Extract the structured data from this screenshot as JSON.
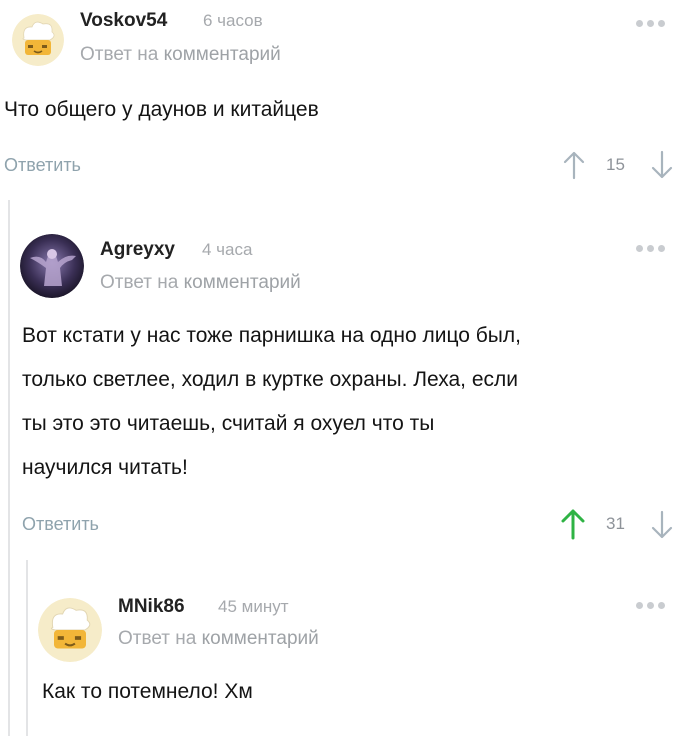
{
  "comments": [
    {
      "username": "Voskov54",
      "time": "6 часов",
      "reply_prefix": "Ответ на",
      "reply_link": "комментарий",
      "text_lines": [
        "Что общего у даунов и китайцев"
      ],
      "reply_label": "Ответить",
      "score": "15",
      "avatar": "chef-hat-avatar",
      "upvoted": false
    },
    {
      "username": "Agreyxy",
      "time": "4 часа",
      "reply_prefix": "Ответ на",
      "reply_link": "комментарий",
      "text_lines": [
        "Вот кстати у нас тоже парнишка на одно лицо был,",
        "только светлее, ходил в куртке охраны. Леха, если",
        "ты это это читаешь, считай я охуел что ты",
        "научился читать!"
      ],
      "reply_label": "Ответить",
      "score": "31",
      "avatar": "photo-avatar",
      "upvoted": true
    },
    {
      "username": "MNik86",
      "time": "45 минут",
      "reply_prefix": "Ответ на",
      "reply_link": "комментарий",
      "text_lines": [
        "Как то потемнело! Хм"
      ],
      "avatar": "chef-hat-avatar"
    }
  ],
  "colors": {
    "upvote_active": "#2fb344",
    "vote_inactive": "#a8b4bd",
    "thread_line": "#e3e4e6"
  }
}
